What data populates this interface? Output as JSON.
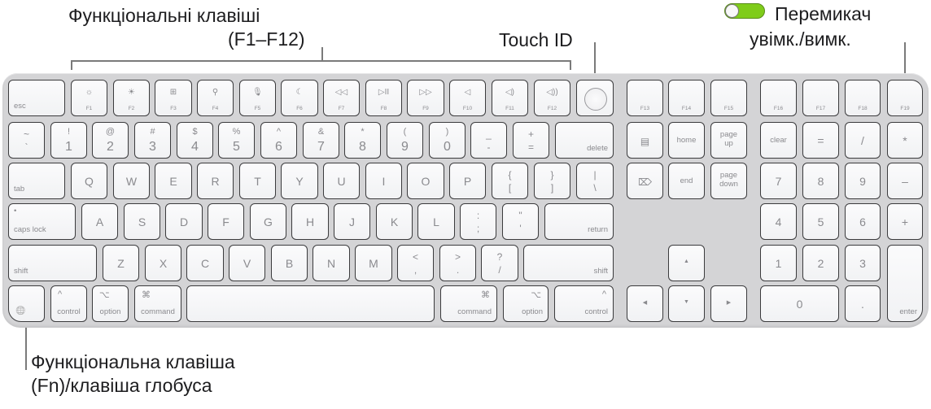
{
  "callouts": {
    "function_keys": {
      "line1": "Функціональні клавіші",
      "line2": "(F1–F12)"
    },
    "touch_id": "Touch ID",
    "power_switch": {
      "line1": "Перемикач",
      "line2": "увімк./вимк."
    },
    "fn_globe": {
      "line1": "Функціональна клавіша",
      "line2": "(Fn)/клавіша глобуса"
    }
  },
  "toggle": {
    "state": "on",
    "color": "#7fcc1a"
  },
  "keyboard": {
    "function_row": [
      {
        "id": "esc",
        "label": "esc"
      },
      {
        "id": "f1",
        "label": "F1",
        "icon": "brightness-down-icon",
        "glyph": "☼"
      },
      {
        "id": "f2",
        "label": "F2",
        "icon": "brightness-up-icon",
        "glyph": "☀"
      },
      {
        "id": "f3",
        "label": "F3",
        "icon": "mission-control-icon",
        "glyph": "⊞"
      },
      {
        "id": "f4",
        "label": "F4",
        "icon": "search-icon",
        "glyph": "⚲"
      },
      {
        "id": "f5",
        "label": "F5",
        "icon": "microphone-icon",
        "glyph": "🎙"
      },
      {
        "id": "f6",
        "label": "F6",
        "icon": "moon-icon",
        "glyph": "☾"
      },
      {
        "id": "f7",
        "label": "F7",
        "icon": "rewind-icon",
        "glyph": "◁◁"
      },
      {
        "id": "f8",
        "label": "F8",
        "icon": "play-pause-icon",
        "glyph": "▷II"
      },
      {
        "id": "f9",
        "label": "F9",
        "icon": "fast-forward-icon",
        "glyph": "▷▷"
      },
      {
        "id": "f10",
        "label": "F10",
        "icon": "mute-icon",
        "glyph": "◁"
      },
      {
        "id": "f11",
        "label": "F11",
        "icon": "volume-down-icon",
        "glyph": "◁)"
      },
      {
        "id": "f12",
        "label": "F12",
        "icon": "volume-up-icon",
        "glyph": "◁))"
      },
      {
        "id": "touchid",
        "label": "",
        "icon": "touch-id-icon"
      },
      {
        "id": "f13",
        "label": "F13"
      },
      {
        "id": "f14",
        "label": "F14"
      },
      {
        "id": "f15",
        "label": "F15"
      },
      {
        "id": "f16",
        "label": "F16"
      },
      {
        "id": "f17",
        "label": "F17"
      },
      {
        "id": "f18",
        "label": "F18"
      },
      {
        "id": "f19",
        "label": "F19"
      }
    ],
    "number_row": [
      {
        "id": "grave",
        "top": "~",
        "bottom": "`"
      },
      {
        "id": "1",
        "top": "!",
        "main": "1"
      },
      {
        "id": "2",
        "top": "@",
        "main": "2"
      },
      {
        "id": "3",
        "top": "#",
        "main": "3"
      },
      {
        "id": "4",
        "top": "$",
        "main": "4"
      },
      {
        "id": "5",
        "top": "%",
        "main": "5"
      },
      {
        "id": "6",
        "top": "^",
        "main": "6"
      },
      {
        "id": "7",
        "top": "&",
        "main": "7"
      },
      {
        "id": "8",
        "top": "*",
        "main": "8"
      },
      {
        "id": "9",
        "top": "(",
        "main": "9"
      },
      {
        "id": "0",
        "top": ")",
        "main": "0"
      },
      {
        "id": "minus",
        "top": "_",
        "bottom": "-"
      },
      {
        "id": "equals",
        "top": "+",
        "bottom": "="
      },
      {
        "id": "delete",
        "label": "delete"
      }
    ],
    "qwerty_row": [
      {
        "id": "tab",
        "label": "tab"
      },
      {
        "id": "q",
        "main": "Q"
      },
      {
        "id": "w",
        "main": "W"
      },
      {
        "id": "e",
        "main": "E"
      },
      {
        "id": "r",
        "main": "R"
      },
      {
        "id": "t",
        "main": "T"
      },
      {
        "id": "y",
        "main": "Y"
      },
      {
        "id": "u",
        "main": "U"
      },
      {
        "id": "i",
        "main": "I"
      },
      {
        "id": "o",
        "main": "O"
      },
      {
        "id": "p",
        "main": "P"
      },
      {
        "id": "lbracket",
        "top": "{",
        "bottom": "["
      },
      {
        "id": "rbracket",
        "top": "}",
        "bottom": "]"
      },
      {
        "id": "backslash",
        "top": "|",
        "bottom": "\\"
      }
    ],
    "home_row": [
      {
        "id": "capslock",
        "label": "caps lock",
        "dot": "•"
      },
      {
        "id": "a",
        "main": "A"
      },
      {
        "id": "s",
        "main": "S"
      },
      {
        "id": "d",
        "main": "D"
      },
      {
        "id": "f",
        "main": "F"
      },
      {
        "id": "g",
        "main": "G"
      },
      {
        "id": "h",
        "main": "H"
      },
      {
        "id": "j",
        "main": "J"
      },
      {
        "id": "k",
        "main": "K"
      },
      {
        "id": "l",
        "main": "L"
      },
      {
        "id": "semicolon",
        "top": ":",
        "bottom": ";"
      },
      {
        "id": "quote",
        "top": "\"",
        "bottom": "'"
      },
      {
        "id": "return",
        "label": "return"
      }
    ],
    "shift_row": [
      {
        "id": "lshift",
        "label": "shift"
      },
      {
        "id": "z",
        "main": "Z"
      },
      {
        "id": "x",
        "main": "X"
      },
      {
        "id": "c",
        "main": "C"
      },
      {
        "id": "v",
        "main": "V"
      },
      {
        "id": "b",
        "main": "B"
      },
      {
        "id": "n",
        "main": "N"
      },
      {
        "id": "m",
        "main": "M"
      },
      {
        "id": "comma",
        "top": "<",
        "bottom": ","
      },
      {
        "id": "period",
        "top": ">",
        "bottom": "."
      },
      {
        "id": "slash",
        "top": "?",
        "bottom": "/"
      },
      {
        "id": "rshift",
        "label": "shift"
      }
    ],
    "bottom_row": [
      {
        "id": "fn",
        "icon": "globe-icon",
        "glyph": "🌐"
      },
      {
        "id": "lcontrol",
        "symbol": "^",
        "label": "control"
      },
      {
        "id": "loption",
        "symbol": "⌥",
        "label": "option"
      },
      {
        "id": "lcommand",
        "symbol": "⌘",
        "label": "command"
      },
      {
        "id": "space",
        "label": ""
      },
      {
        "id": "rcommand",
        "symbol": "⌘",
        "label": "command"
      },
      {
        "id": "roption",
        "symbol": "⌥",
        "label": "option"
      },
      {
        "id": "rcontrol",
        "symbol": "^",
        "label": "control"
      }
    ],
    "nav_cluster": [
      {
        "id": "docs",
        "icon": "document-icon",
        "glyph": "▤"
      },
      {
        "id": "home",
        "label": "home"
      },
      {
        "id": "pageup",
        "label": "page\nup"
      },
      {
        "id": "fwddelete",
        "icon": "forward-delete-icon",
        "glyph": "⌦"
      },
      {
        "id": "end",
        "label": "end"
      },
      {
        "id": "pagedown",
        "label": "page\ndown"
      },
      {
        "id": "up",
        "glyph": "▲"
      },
      {
        "id": "left",
        "glyph": "◀"
      },
      {
        "id": "down",
        "glyph": "▼"
      },
      {
        "id": "right",
        "glyph": "▶"
      }
    ],
    "numpad": [
      {
        "id": "clear",
        "label": "clear"
      },
      {
        "id": "np_equals",
        "main": "="
      },
      {
        "id": "np_slash",
        "main": "/"
      },
      {
        "id": "np_star",
        "main": "*"
      },
      {
        "id": "np7",
        "main": "7"
      },
      {
        "id": "np8",
        "main": "8"
      },
      {
        "id": "np9",
        "main": "9"
      },
      {
        "id": "np_minus",
        "main": "–"
      },
      {
        "id": "np4",
        "main": "4"
      },
      {
        "id": "np5",
        "main": "5"
      },
      {
        "id": "np6",
        "main": "6"
      },
      {
        "id": "np_plus",
        "main": "+"
      },
      {
        "id": "np1",
        "main": "1"
      },
      {
        "id": "np2",
        "main": "2"
      },
      {
        "id": "np3",
        "main": "3"
      },
      {
        "id": "enter",
        "label": "enter"
      },
      {
        "id": "np0",
        "main": "0"
      },
      {
        "id": "np_dot",
        "main": "."
      }
    ]
  }
}
